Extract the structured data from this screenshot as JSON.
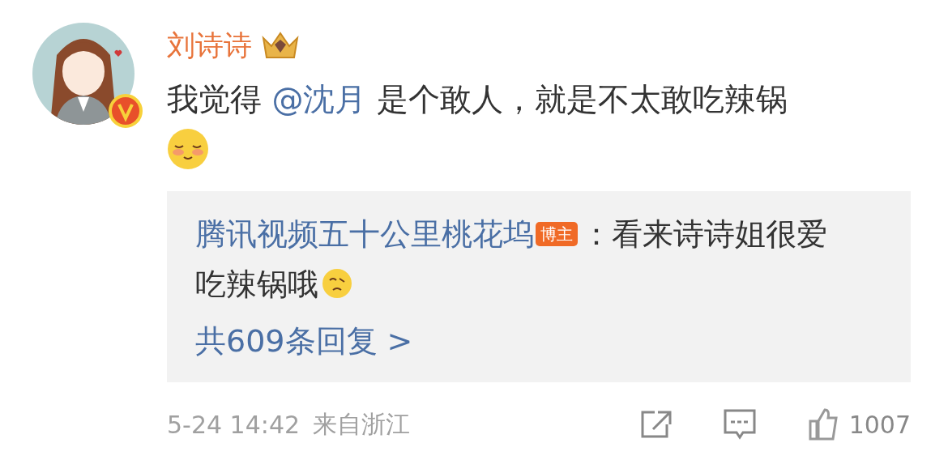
{
  "author": {
    "name": "刘诗诗",
    "verified": true
  },
  "content": [
    {
      "kind": "text",
      "text": "我觉得 "
    },
    {
      "kind": "mention",
      "text": "@沈月"
    },
    {
      "kind": "text",
      "text": " 是个敢人，就是不太敢吃辣锅"
    },
    {
      "kind": "emoji"
    }
  ],
  "reply": {
    "author": "腾讯视频五十公里桃花坞",
    "badge": "博主",
    "text": "：看来诗诗姐很爱吃辣锅哦",
    "more": "共609条回复 >"
  },
  "footer": {
    "date": "5-24 14:42",
    "source": "来自浙江",
    "likes": "1007"
  }
}
